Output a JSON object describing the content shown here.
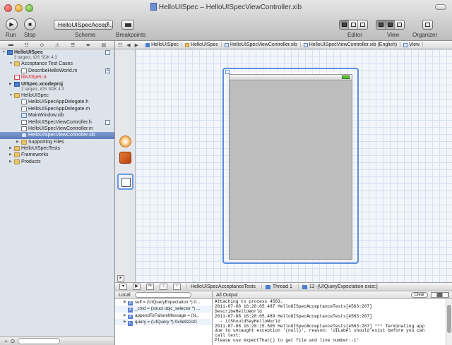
{
  "window": {
    "title": "HelloUISpec – HelloUISpecViewController.xib"
  },
  "toolbar": {
    "run_label": "Run",
    "stop_label": "Stop",
    "scheme_label": "Scheme",
    "scheme_value": "HelloUISpecAccep...",
    "breakpoints_label": "Breakpoints",
    "editor_label": "Editor",
    "view_label": "View",
    "organizer_label": "Organizer"
  },
  "navigator": {
    "items": [
      {
        "label": "HelloUISpec",
        "kind": "project",
        "indent": 0,
        "bold": true
      },
      {
        "label": "3 targets, iOS SDK 4.3",
        "kind": "subtitle",
        "indent": 0
      },
      {
        "label": "Acceptance Test Cases",
        "kind": "folder",
        "indent": 1
      },
      {
        "label": "DescribeHelloWorld.m",
        "kind": "file-m",
        "indent": 2,
        "badge": "A"
      },
      {
        "label": "libUISpec.a",
        "kind": "lib",
        "indent": 1,
        "red": true
      },
      {
        "label": "UISpec.xcodeproj",
        "kind": "project",
        "indent": 1,
        "bold": true
      },
      {
        "label": "2 targets, iOS SDK 4.3",
        "kind": "subtitle",
        "indent": 1
      },
      {
        "label": "HelloUISpec",
        "kind": "folder",
        "indent": 1
      },
      {
        "label": "HelloUISpecAppDelegate.h",
        "kind": "file-h",
        "indent": 2
      },
      {
        "label": "HelloUISpecAppDelegate.m",
        "kind": "file-m",
        "indent": 2
      },
      {
        "label": "MainWindow.xib",
        "kind": "file-xib",
        "indent": 2
      },
      {
        "label": "HelloUISpecViewController.h",
        "kind": "file-h",
        "indent": 2
      },
      {
        "label": "HelloUISpecViewController.m",
        "kind": "file-m",
        "indent": 2
      },
      {
        "label": "HelloUISpecViewController.xib",
        "kind": "file-xib",
        "indent": 2,
        "selected": true
      },
      {
        "label": "Supporting Files",
        "kind": "folder",
        "indent": 2
      },
      {
        "label": "HelloUISpecTests",
        "kind": "folder",
        "indent": 1
      },
      {
        "label": "Frameworks",
        "kind": "folder",
        "indent": 1
      },
      {
        "label": "Products",
        "kind": "folder",
        "indent": 1
      }
    ]
  },
  "jumpbar": {
    "crumbs": [
      "HelloUISpec",
      "HelloUISpec",
      "HelloUISpecViewController.xib",
      "HelloUISpecViewController.xib (English)",
      "View"
    ]
  },
  "debugbar": {
    "crumbs": [
      "HelloUISpecAcceptanceTests",
      "Thread 1",
      "12 -[UIQueryExpectation exist:]"
    ]
  },
  "variables": {
    "scope": "Local",
    "rows": [
      "self = (UIQueryExpectation *) 0...",
      "_cmd = (struct objc_selector *) ...",
      "appendToFailureMessage = (N...",
      "query = (UIQuery *) 0x4e92310"
    ]
  },
  "console": {
    "output_label": "All Output",
    "clear_label": "Clear",
    "lines": [
      "Attaching to process 4563.",
      "2011-07-08 16:28:05.487 HelloUISpecAcceptanceTests[4563:207]",
      "DescribeHelloWorld",
      "2011-07-08 16:28:05.489 HelloUISpecAcceptanceTests[4563:207]",
      "  - itShouldSayHelloWorld",
      "2011-07-08 16:28:15.505 HelloUISpecAcceptanceTests[4563:207] *** Terminating app",
      "due to uncaught exception '(null)', reason: 'UILabel should exist before you can",
      "call text:",
      "Please use expectThat() to get file and line number:-1'"
    ]
  },
  "colors": {
    "selection": "#5b7bbd",
    "ib_selection": "#5b8ed9",
    "navigator_bg": "#dde3ea"
  }
}
